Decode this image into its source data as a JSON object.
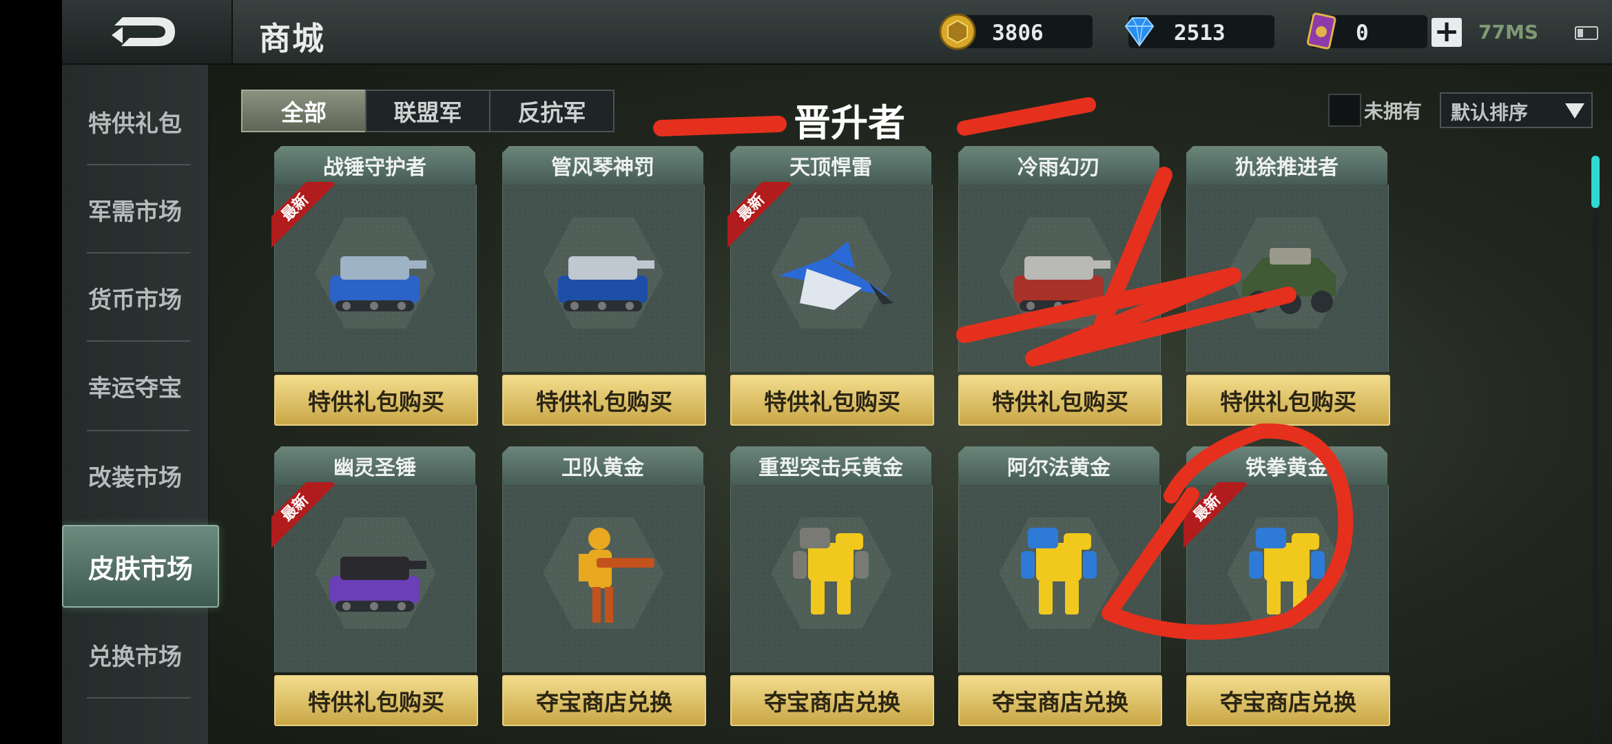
{
  "topbar": {
    "title": "商城",
    "coins": "3806",
    "diamonds": "2513",
    "cards": "0",
    "ping": "77MS",
    "colors": {
      "coin": "#d8a929",
      "diamond": "#2a8ef0",
      "card": "#8e3aa8"
    }
  },
  "sidebar": {
    "items": [
      {
        "label": "特供礼包"
      },
      {
        "label": "军需市场"
      },
      {
        "label": "货币市场"
      },
      {
        "label": "幸运夺宝"
      },
      {
        "label": "改装市场"
      },
      {
        "label": "皮肤市场"
      },
      {
        "label": "兑换市场"
      }
    ],
    "active_index": 5
  },
  "tabs": [
    {
      "label": "全部",
      "active": true
    },
    {
      "label": "联盟军",
      "active": false
    },
    {
      "label": "反抗军",
      "active": false
    }
  ],
  "filter": {
    "label": "未拥有",
    "checked": false
  },
  "sort": {
    "selected": "默认排序"
  },
  "annotation": {
    "text": "晋升者",
    "color": "#e5301d"
  },
  "badge_new": "最新",
  "cards": [
    {
      "name": "战锤守护者",
      "button": "特供礼包购买",
      "new": true,
      "icon": "tank-icon",
      "palette": [
        "#2c63c9",
        "#9fb3c7"
      ]
    },
    {
      "name": "管风琴神罚",
      "button": "特供礼包购买",
      "new": false,
      "icon": "tank-icon",
      "palette": [
        "#1e4fa8",
        "#bfc7d0"
      ]
    },
    {
      "name": "天顶悍雷",
      "button": "特供礼包购买",
      "new": true,
      "icon": "jet-icon",
      "palette": [
        "#2b6ad6",
        "#e0e6ee"
      ]
    },
    {
      "name": "冷雨幻刃",
      "button": "特供礼包购买",
      "new": false,
      "icon": "tank-icon",
      "palette": [
        "#a83228",
        "#b9b9b6"
      ]
    },
    {
      "name": "犰狳推进者",
      "button": "特供礼包购买",
      "new": false,
      "icon": "armored-car-icon",
      "palette": [
        "#3f5a34",
        "#9a9a8c"
      ]
    },
    {
      "name": "幽灵圣锤",
      "button": "特供礼包购买",
      "new": true,
      "icon": "tank-icon",
      "palette": [
        "#6a3fb8",
        "#2a2a2e"
      ]
    },
    {
      "name": "卫队黄金",
      "button": "夺宝商店兑换",
      "new": false,
      "icon": "soldier-icon",
      "palette": [
        "#e8a820",
        "#c4521c"
      ]
    },
    {
      "name": "重型突击兵黄金",
      "button": "夺宝商店兑换",
      "new": false,
      "icon": "mech-icon",
      "palette": [
        "#f0c81e",
        "#7a7a74"
      ]
    },
    {
      "name": "阿尔法黄金",
      "button": "夺宝商店兑换",
      "new": false,
      "icon": "mech-icon",
      "palette": [
        "#f0c81e",
        "#2d7bd6"
      ]
    },
    {
      "name": "铁拳黄金",
      "button": "夺宝商店兑换",
      "new": true,
      "icon": "mech-icon",
      "palette": [
        "#f0c81e",
        "#2d7bd6"
      ]
    }
  ]
}
